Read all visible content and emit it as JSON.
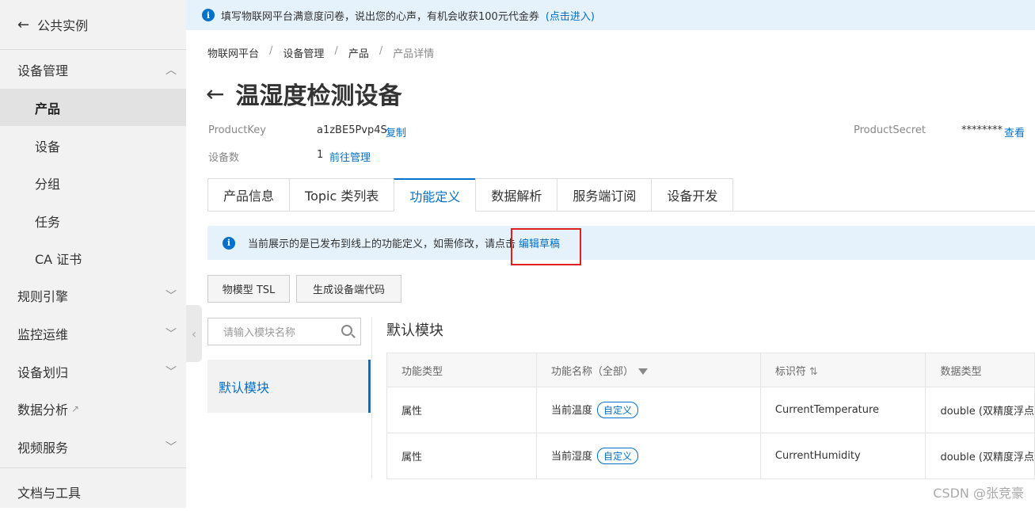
{
  "sidebar": {
    "back_label": "公共实例",
    "sections": [
      {
        "label": "设备管理"
      },
      {
        "label": "规则引擎"
      },
      {
        "label": "监控运维"
      },
      {
        "label": "设备划归"
      },
      {
        "label": "数据分析"
      },
      {
        "label": "视频服务"
      },
      {
        "label": "文档与工具"
      }
    ],
    "items": [
      {
        "label": "产品"
      },
      {
        "label": "设备"
      },
      {
        "label": "分组"
      },
      {
        "label": "任务"
      },
      {
        "label": "CA 证书"
      }
    ]
  },
  "banner": {
    "text": "填写物联网平台满意度问卷，说出您的心声，有机会收获100元代金券",
    "link": "(点击进入)"
  },
  "breadcrumb": [
    "物联网平台",
    "设备管理",
    "产品",
    "产品详情"
  ],
  "page": {
    "title": "温湿度检测设备"
  },
  "meta": {
    "product_key_label": "ProductKey",
    "product_key_value": "a1zBE5Pvp4S",
    "copy_label": "复制",
    "device_count_label": "设备数",
    "device_count_value": "1",
    "manage_link": "前往管理",
    "product_secret_label": "ProductSecret",
    "product_secret_value": "********",
    "view_label": "查看"
  },
  "tabs": [
    {
      "label": "产品信息"
    },
    {
      "label": "Topic 类列表"
    },
    {
      "label": "功能定义"
    },
    {
      "label": "数据解析"
    },
    {
      "label": "服务端订阅"
    },
    {
      "label": "设备开发"
    }
  ],
  "notice": {
    "text": "当前展示的是已发布到线上的功能定义，如需修改，请点击",
    "link": "编辑草稿"
  },
  "buttons": {
    "tsl": "物模型 TSL",
    "gen_code": "生成设备端代码"
  },
  "search": {
    "placeholder": "请输入模块名称"
  },
  "module": {
    "item": "默认模块",
    "title": "默认模块"
  },
  "table": {
    "headers": [
      "功能类型",
      "功能名称（全部）",
      "标识符",
      "数据类型"
    ],
    "rows": [
      {
        "type": "属性",
        "name": "当前温度",
        "tag": "自定义",
        "id": "CurrentTemperature",
        "dtype": "double (双精度浮点"
      },
      {
        "type": "属性",
        "name": "当前湿度",
        "tag": "自定义",
        "id": "CurrentHumidity",
        "dtype": "double (双精度浮点"
      }
    ]
  },
  "watermark": "CSDN @张竞豪"
}
